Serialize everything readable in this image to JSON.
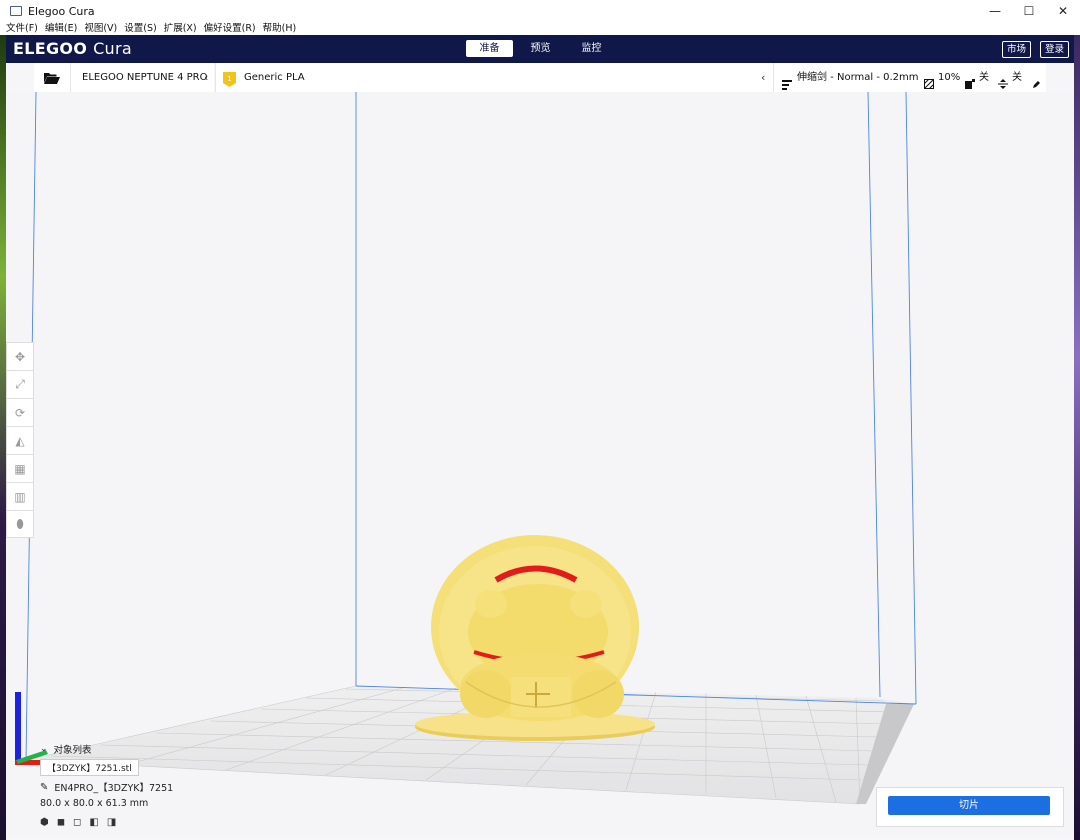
{
  "window": {
    "title": "Elegoo Cura",
    "controls": [
      "—",
      "☐",
      "✕"
    ]
  },
  "menu": [
    "文件(F)",
    "编辑(E)",
    "视图(V)",
    "设置(S)",
    "扩展(X)",
    "偏好设置(R)",
    "帮助(H)"
  ],
  "header": {
    "logo_main": "ELEGOO",
    "logo_sub": "Cura",
    "tabs": [
      "准备",
      "预览",
      "监控"
    ],
    "active_tab": "准备",
    "marketplace": "市场",
    "login": "登录"
  },
  "toolbar": {
    "printer": "ELEGOO NEPTUNE 4 PRO",
    "material_badge": "1",
    "material": "Generic PLA",
    "profile": "伸缩剑 - Normal - 0.2mm",
    "infill": "10%",
    "support": "关",
    "adhesion": "关"
  },
  "objects": {
    "header": "对象列表",
    "file_name": "【3DZYK】7251.stl",
    "object_name": "EN4PRO_【3DZYK】7251",
    "dimensions": "80.0 x 80.0 x 61.3 mm"
  },
  "slice": {
    "button": "切片"
  },
  "colors": {
    "header_bg": "#0f1848",
    "accent": "#1c6fe3",
    "model": "#f6df7a",
    "overhang": "#e21b1b"
  }
}
